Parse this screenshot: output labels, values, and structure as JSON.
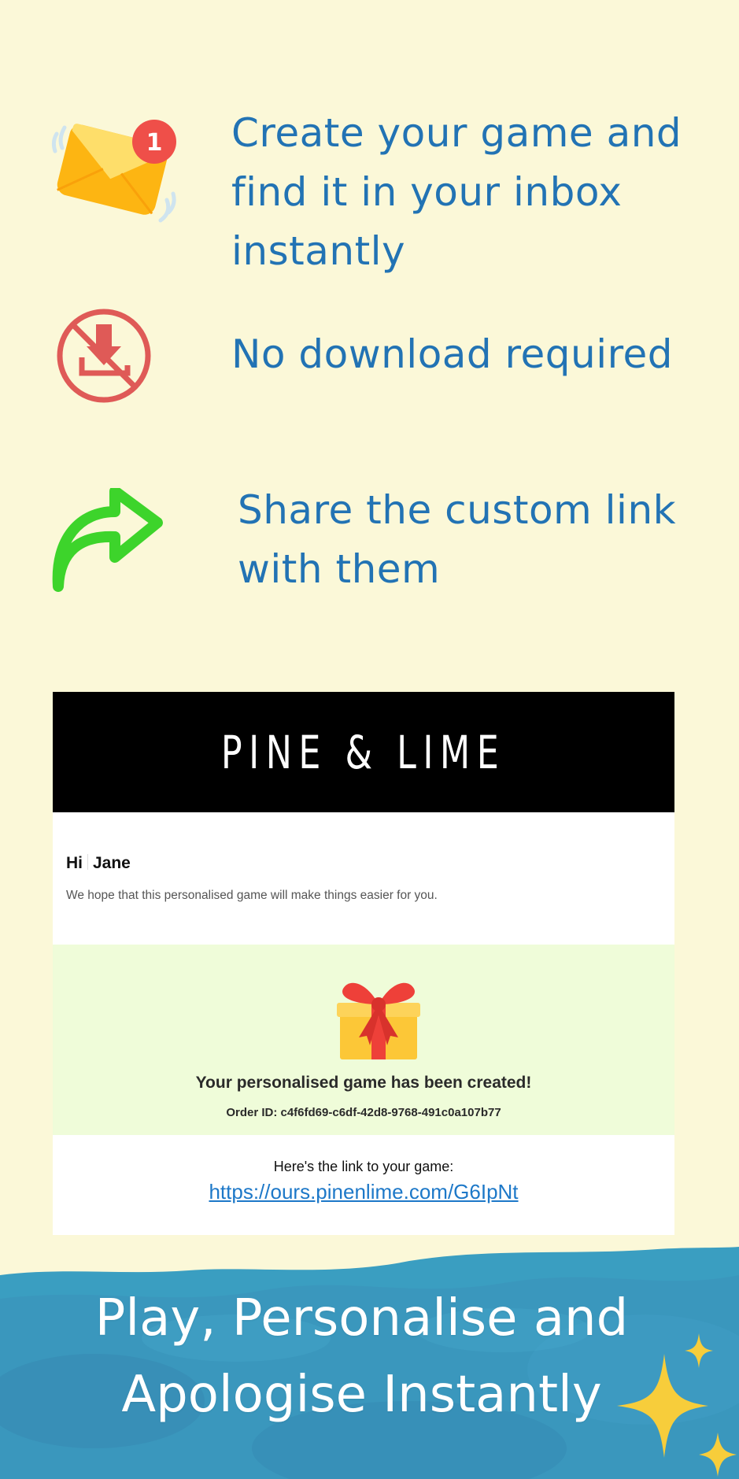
{
  "features": [
    {
      "icon": "mail-notification-icon",
      "badge": "1",
      "text": "Create your game and find it in your inbox instantly"
    },
    {
      "icon": "no-download-icon",
      "text": "No download required"
    },
    {
      "icon": "share-arrow-icon",
      "text": "Share the custom link with them"
    }
  ],
  "email": {
    "brand": "PINE & LIME",
    "greeting_hi": "Hi",
    "greeting_name": "Jane",
    "message": "We hope that this personalised game will make things easier for you.",
    "gift_icon": "gift-icon",
    "created_title": "Your personalised game has been created!",
    "order_id": "Order ID: c4f6fd69-c6df-42d8-9768-491c0a107b77",
    "link_label": "Here's the link to your game:",
    "link_url": "https://ours.pinenlime.com/G6IpNt"
  },
  "footer": {
    "line1": "Play, Personalise and",
    "line2": "Apologise Instantly"
  },
  "colors": {
    "background": "#fbf8d8",
    "feature_text": "#2273b4",
    "email_green": "#effcd9",
    "link": "#1d78c8",
    "water": "#3a9ec1",
    "sparkle": "#f7cd3b"
  }
}
